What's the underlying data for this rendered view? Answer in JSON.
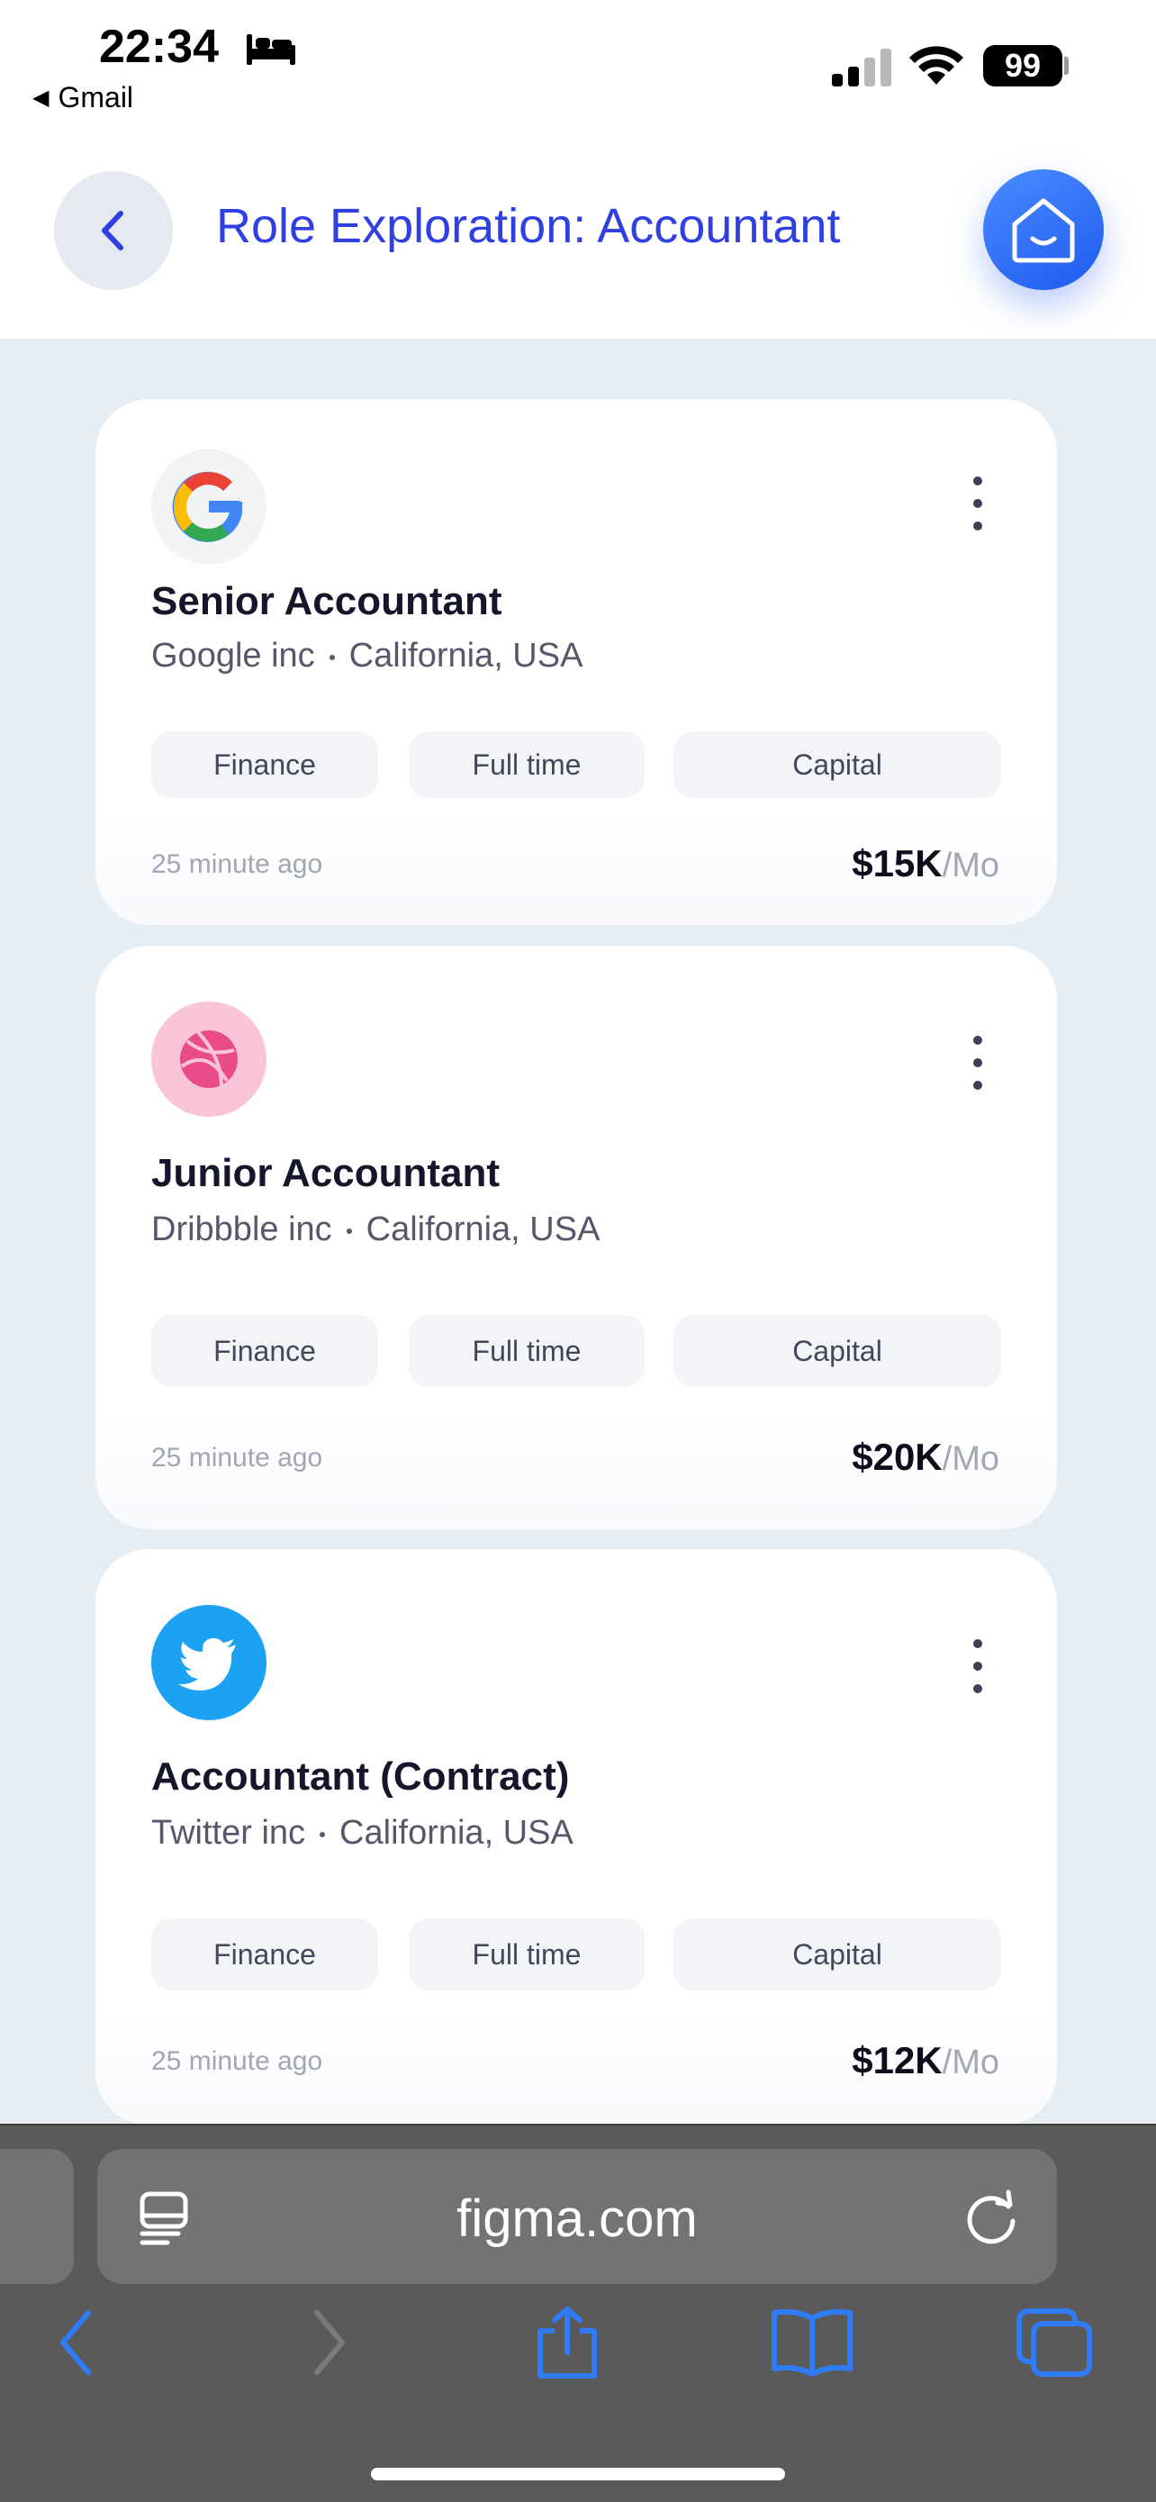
{
  "status_bar": {
    "time": "22:34",
    "back_app": "Gmail",
    "battery": "99",
    "icons": [
      "bed-icon",
      "signal-icon",
      "wifi-icon",
      "battery-icon"
    ]
  },
  "header": {
    "title": "Role Exploration: Accountant",
    "back_icon": "chevron-left-icon",
    "home_icon": "home-icon"
  },
  "jobs": [
    {
      "logo": "google-logo",
      "title": "Senior Accountant",
      "company": "Google inc",
      "location": "California, USA",
      "tags": [
        "Finance",
        "Full time",
        "Capital"
      ],
      "posted": "25 minute ago",
      "salary": "$15K",
      "period": "/Mo"
    },
    {
      "logo": "dribbble-logo",
      "title": "Junior Accountant",
      "company": "Dribbble inc",
      "location": "California, USA",
      "tags": [
        "Finance",
        "Full time",
        "Capital"
      ],
      "posted": "25 minute ago",
      "salary": "$20K",
      "period": "/Mo"
    },
    {
      "logo": "twitter-logo",
      "title": "Accountant (Contract)",
      "company": "Twitter inc",
      "location": "California, USA",
      "tags": [
        "Finance",
        "Full time",
        "Capital"
      ],
      "posted": "25 minute ago",
      "salary": "$12K",
      "period": "/Mo"
    }
  ],
  "browser": {
    "url": "figma.com",
    "toolbar": [
      "back-icon",
      "forward-icon",
      "share-icon",
      "bookmarks-icon",
      "tabs-icon"
    ]
  },
  "colors": {
    "accent": "#2f3fe0",
    "home_button": "#2f6bf6",
    "dribbble": "#ea4c89",
    "twitter": "#1da1f2"
  }
}
